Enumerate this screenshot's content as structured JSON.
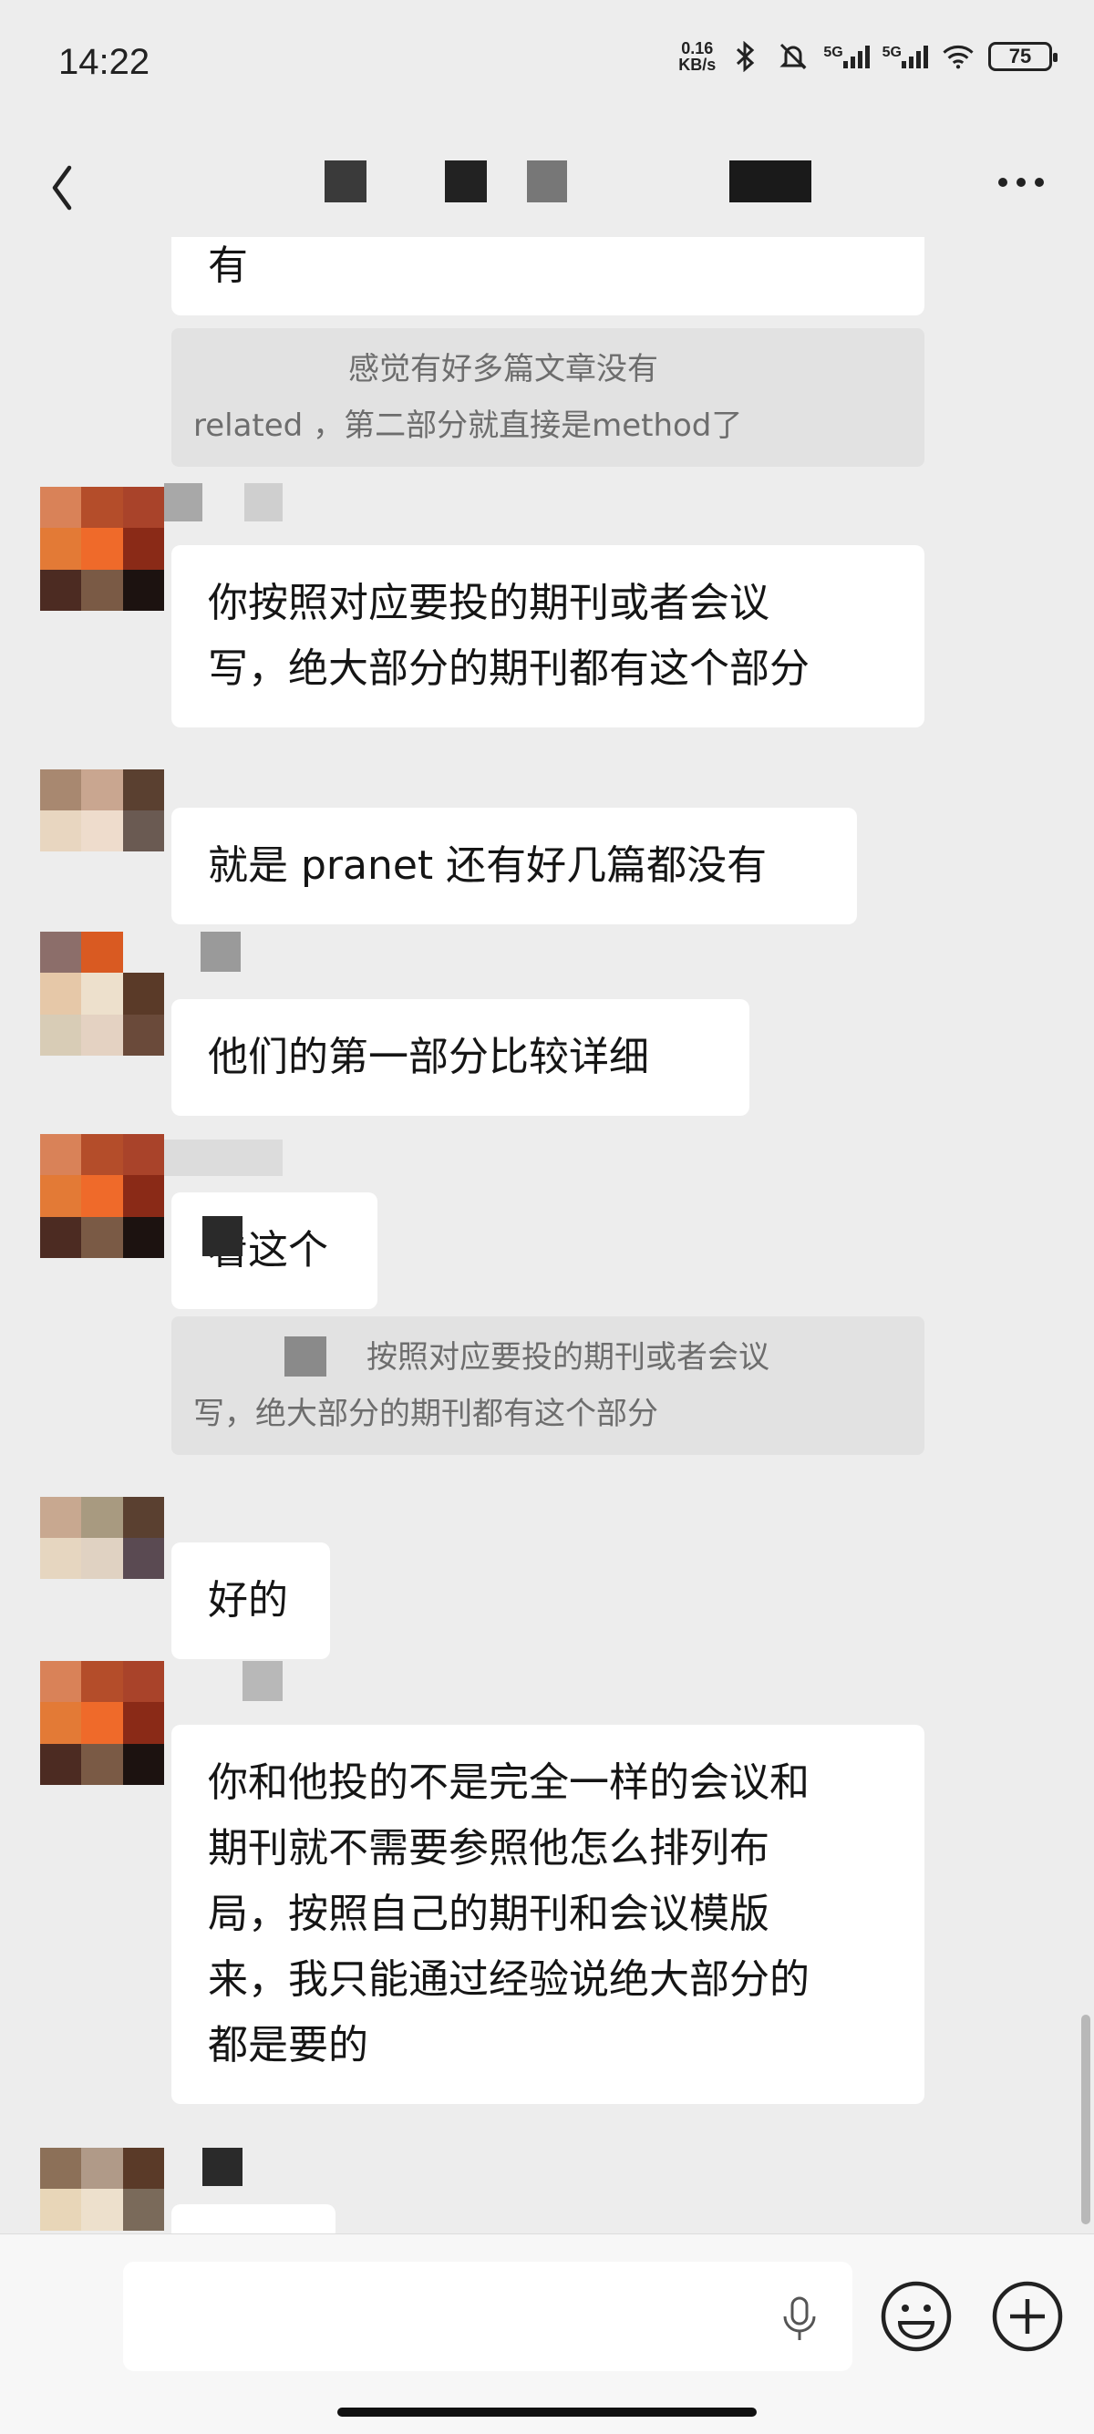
{
  "status_bar": {
    "time": "14:22",
    "net_speed_value": "0.16",
    "net_speed_unit": "KB/s",
    "signal_label_1": "5G",
    "signal_label_2": "5G",
    "battery": "75"
  },
  "header": {
    "back_icon": "chevron-left-icon",
    "more_icon": "more-dots-icon"
  },
  "messages": [
    {
      "text": "有"
    },
    {
      "quote_line1": "感觉有好多篇文章没有",
      "quote_line2": "related ，第二部分就直接是method了"
    },
    {
      "line1": "你按照对应要投的期刊或者会议",
      "line2": "写，绝大部分的期刊都有这个部分"
    },
    {
      "text": "就是 pranet 还有好几篇都没有"
    },
    {
      "text": "他们的第一部分比较详细"
    },
    {
      "text": "看这个"
    },
    {
      "quote_line1": "按照对应要投的期刊或者会议",
      "quote_line2": "写，绝大部分的期刊都有这个部分"
    },
    {
      "text": "好的"
    },
    {
      "line1": "你和他投的不是完全一样的会议和",
      "line2": "期刊就不需要参照他怎么排列布",
      "line3": "局，按照自己的期刊和会议模版",
      "line4": "来，我只能通过经验说绝大部分的",
      "line5": "都是要的"
    }
  ],
  "input_bar": {
    "mic_icon": "microphone-icon",
    "emoji_icon": "emoji-icon",
    "plus_icon": "plus-circle-icon"
  },
  "colors": {
    "background": "#ededed",
    "bubble": "#ffffff",
    "quote": "#e2e2e2"
  }
}
